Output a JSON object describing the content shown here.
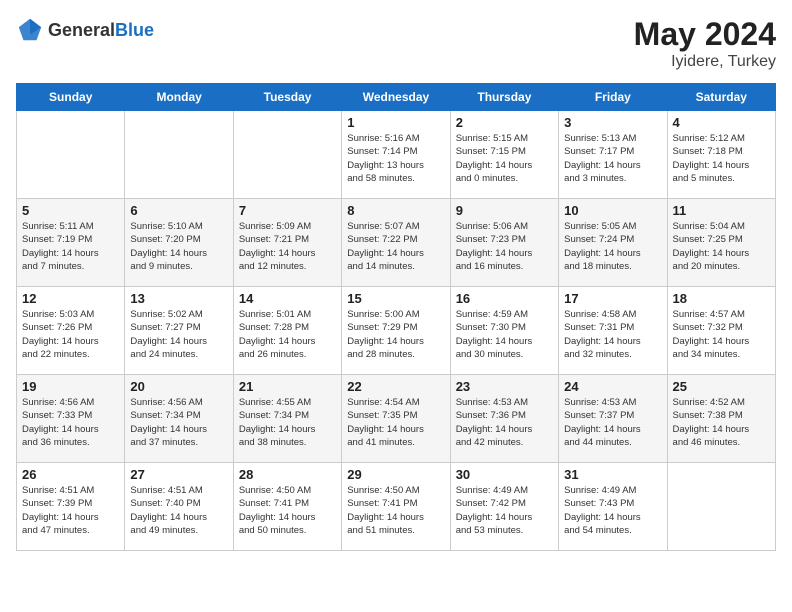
{
  "header": {
    "logo_general": "General",
    "logo_blue": "Blue",
    "month_year": "May 2024",
    "location": "Iyidere, Turkey"
  },
  "days_of_week": [
    "Sunday",
    "Monday",
    "Tuesday",
    "Wednesday",
    "Thursday",
    "Friday",
    "Saturday"
  ],
  "weeks": [
    [
      {
        "day": "",
        "info": ""
      },
      {
        "day": "",
        "info": ""
      },
      {
        "day": "",
        "info": ""
      },
      {
        "day": "1",
        "info": "Sunrise: 5:16 AM\nSunset: 7:14 PM\nDaylight: 13 hours\nand 58 minutes."
      },
      {
        "day": "2",
        "info": "Sunrise: 5:15 AM\nSunset: 7:15 PM\nDaylight: 14 hours\nand 0 minutes."
      },
      {
        "day": "3",
        "info": "Sunrise: 5:13 AM\nSunset: 7:17 PM\nDaylight: 14 hours\nand 3 minutes."
      },
      {
        "day": "4",
        "info": "Sunrise: 5:12 AM\nSunset: 7:18 PM\nDaylight: 14 hours\nand 5 minutes."
      }
    ],
    [
      {
        "day": "5",
        "info": "Sunrise: 5:11 AM\nSunset: 7:19 PM\nDaylight: 14 hours\nand 7 minutes."
      },
      {
        "day": "6",
        "info": "Sunrise: 5:10 AM\nSunset: 7:20 PM\nDaylight: 14 hours\nand 9 minutes."
      },
      {
        "day": "7",
        "info": "Sunrise: 5:09 AM\nSunset: 7:21 PM\nDaylight: 14 hours\nand 12 minutes."
      },
      {
        "day": "8",
        "info": "Sunrise: 5:07 AM\nSunset: 7:22 PM\nDaylight: 14 hours\nand 14 minutes."
      },
      {
        "day": "9",
        "info": "Sunrise: 5:06 AM\nSunset: 7:23 PM\nDaylight: 14 hours\nand 16 minutes."
      },
      {
        "day": "10",
        "info": "Sunrise: 5:05 AM\nSunset: 7:24 PM\nDaylight: 14 hours\nand 18 minutes."
      },
      {
        "day": "11",
        "info": "Sunrise: 5:04 AM\nSunset: 7:25 PM\nDaylight: 14 hours\nand 20 minutes."
      }
    ],
    [
      {
        "day": "12",
        "info": "Sunrise: 5:03 AM\nSunset: 7:26 PM\nDaylight: 14 hours\nand 22 minutes."
      },
      {
        "day": "13",
        "info": "Sunrise: 5:02 AM\nSunset: 7:27 PM\nDaylight: 14 hours\nand 24 minutes."
      },
      {
        "day": "14",
        "info": "Sunrise: 5:01 AM\nSunset: 7:28 PM\nDaylight: 14 hours\nand 26 minutes."
      },
      {
        "day": "15",
        "info": "Sunrise: 5:00 AM\nSunset: 7:29 PM\nDaylight: 14 hours\nand 28 minutes."
      },
      {
        "day": "16",
        "info": "Sunrise: 4:59 AM\nSunset: 7:30 PM\nDaylight: 14 hours\nand 30 minutes."
      },
      {
        "day": "17",
        "info": "Sunrise: 4:58 AM\nSunset: 7:31 PM\nDaylight: 14 hours\nand 32 minutes."
      },
      {
        "day": "18",
        "info": "Sunrise: 4:57 AM\nSunset: 7:32 PM\nDaylight: 14 hours\nand 34 minutes."
      }
    ],
    [
      {
        "day": "19",
        "info": "Sunrise: 4:56 AM\nSunset: 7:33 PM\nDaylight: 14 hours\nand 36 minutes."
      },
      {
        "day": "20",
        "info": "Sunrise: 4:56 AM\nSunset: 7:34 PM\nDaylight: 14 hours\nand 37 minutes."
      },
      {
        "day": "21",
        "info": "Sunrise: 4:55 AM\nSunset: 7:34 PM\nDaylight: 14 hours\nand 38 minutes."
      },
      {
        "day": "22",
        "info": "Sunrise: 4:54 AM\nSunset: 7:35 PM\nDaylight: 14 hours\nand 41 minutes."
      },
      {
        "day": "23",
        "info": "Sunrise: 4:53 AM\nSunset: 7:36 PM\nDaylight: 14 hours\nand 42 minutes."
      },
      {
        "day": "24",
        "info": "Sunrise: 4:53 AM\nSunset: 7:37 PM\nDaylight: 14 hours\nand 44 minutes."
      },
      {
        "day": "25",
        "info": "Sunrise: 4:52 AM\nSunset: 7:38 PM\nDaylight: 14 hours\nand 46 minutes."
      }
    ],
    [
      {
        "day": "26",
        "info": "Sunrise: 4:51 AM\nSunset: 7:39 PM\nDaylight: 14 hours\nand 47 minutes."
      },
      {
        "day": "27",
        "info": "Sunrise: 4:51 AM\nSunset: 7:40 PM\nDaylight: 14 hours\nand 49 minutes."
      },
      {
        "day": "28",
        "info": "Sunrise: 4:50 AM\nSunset: 7:41 PM\nDaylight: 14 hours\nand 50 minutes."
      },
      {
        "day": "29",
        "info": "Sunrise: 4:50 AM\nSunset: 7:41 PM\nDaylight: 14 hours\nand 51 minutes."
      },
      {
        "day": "30",
        "info": "Sunrise: 4:49 AM\nSunset: 7:42 PM\nDaylight: 14 hours\nand 53 minutes."
      },
      {
        "day": "31",
        "info": "Sunrise: 4:49 AM\nSunset: 7:43 PM\nDaylight: 14 hours\nand 54 minutes."
      },
      {
        "day": "",
        "info": ""
      }
    ]
  ]
}
